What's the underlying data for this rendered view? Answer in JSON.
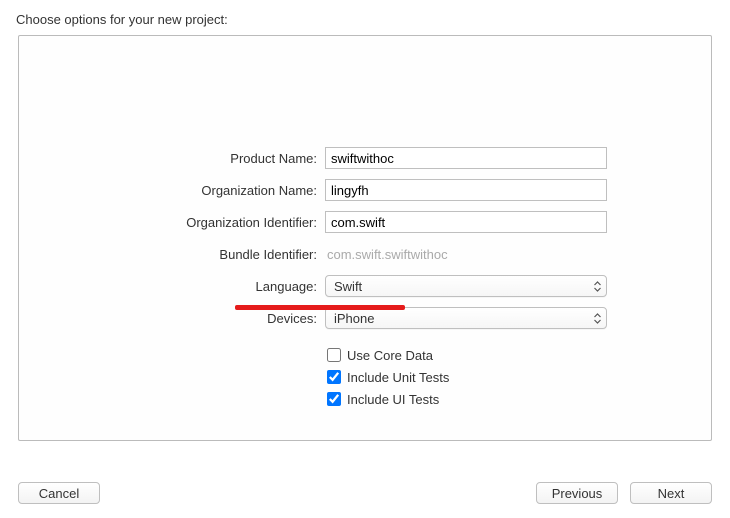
{
  "header": {
    "title": "Choose options for your new project:"
  },
  "form": {
    "productName": {
      "label": "Product Name:",
      "value": "swiftwithoc"
    },
    "orgName": {
      "label": "Organization Name:",
      "value": "lingyfh"
    },
    "orgIdentifier": {
      "label": "Organization Identifier:",
      "value": "com.swift"
    },
    "bundleIdentifier": {
      "label": "Bundle Identifier:",
      "value": "com.swift.swiftwithoc"
    },
    "language": {
      "label": "Language:",
      "value": "Swift"
    },
    "devices": {
      "label": "Devices:",
      "value": "iPhone"
    },
    "useCoreData": {
      "label": "Use Core Data",
      "checked": false
    },
    "includeUnitTests": {
      "label": "Include Unit Tests",
      "checked": true
    },
    "includeUITests": {
      "label": "Include UI Tests",
      "checked": true
    }
  },
  "buttons": {
    "cancel": "Cancel",
    "previous": "Previous",
    "next": "Next"
  }
}
